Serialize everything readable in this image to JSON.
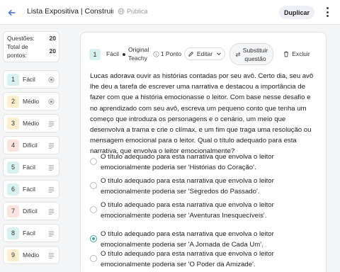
{
  "header": {
    "title": "Lista Expositiva | Construin...",
    "visibility": "Pública",
    "duplicate_label": "Duplicar"
  },
  "stats": {
    "questions_label": "Questões:",
    "questions_value": "20",
    "points_label_1": "Total de",
    "points_label_2": "pontos:",
    "points_value": "20"
  },
  "sidebar": {
    "items": [
      {
        "num": "1",
        "level": "Fácil",
        "color": "#d9f1ef",
        "icon": "radio"
      },
      {
        "num": "2",
        "level": "Médio",
        "color": "#fbefd0",
        "icon": "radio"
      },
      {
        "num": "3",
        "level": "Médio",
        "color": "#fbefd0",
        "icon": "lines"
      },
      {
        "num": "4",
        "level": "Difícil",
        "color": "#fbe3df",
        "icon": "lines"
      },
      {
        "num": "5",
        "level": "Fácil",
        "color": "#d9f1ef",
        "icon": "lines"
      },
      {
        "num": "6",
        "level": "Fácil",
        "color": "#d9f1ef",
        "icon": "lines"
      },
      {
        "num": "7",
        "level": "Difícil",
        "color": "#fbe3df",
        "icon": "lines"
      },
      {
        "num": "8",
        "level": "Fácil",
        "color": "#d9f1ef",
        "icon": "lines"
      },
      {
        "num": "9",
        "level": "Médio",
        "color": "#fbefd0",
        "icon": "lines"
      }
    ]
  },
  "question": {
    "number": "1",
    "level": "Fácil",
    "origin_line1": "Original",
    "origin_line2": "Teachy",
    "points": "1 Ponto",
    "edit_label": "Editar",
    "replace_line1": "Substituir",
    "replace_line2": "questão",
    "delete_label": "Excluir",
    "text": "Lucas adorava ouvir as histórias contadas por seu avô. Certo dia, seu avô lhe deu a tarefa de escrever uma narrativa e destacou a importância de fazer com que a história emocionasse o leitor. Com base nesse desafio e no aprendizado com seu avô, escreva um pequeno conto que tenha um começo que introduza os personagens e o cenário, um meio que desenvolva a trama e crie o clímax, e um fim que traga uma resolução ou mensagem emocional para o leitor. Qual o título adequado para esta narrativa, que envolva o leitor emocionalmente?",
    "options": [
      {
        "text": "O título adequado para esta narrativa que envolva o leitor emocionalmente poderia ser 'Histórias do Coração'.",
        "selected": false
      },
      {
        "text": "O título adequado para esta narrativa que envolva o leitor emocionalmente poderia ser 'Segredos do Passado'.",
        "selected": false
      },
      {
        "text": "O título adequado para esta narrativa que envolva o leitor emocionalmente poderia ser 'Aventuras Inesquecíveis'.",
        "selected": false
      },
      {
        "text": "O título adequado para esta narrativa que envolva o leitor emocionalmente poderia ser 'A Jornada de Cada Um'.",
        "selected": true
      },
      {
        "text": "O título adequado para esta narrativa que envolva o leitor emocionalmente poderia ser 'O Poder da Amizade'.",
        "selected": false
      }
    ]
  },
  "colors": {
    "accent": "#3ca79e",
    "link": "#3b6fd8"
  }
}
